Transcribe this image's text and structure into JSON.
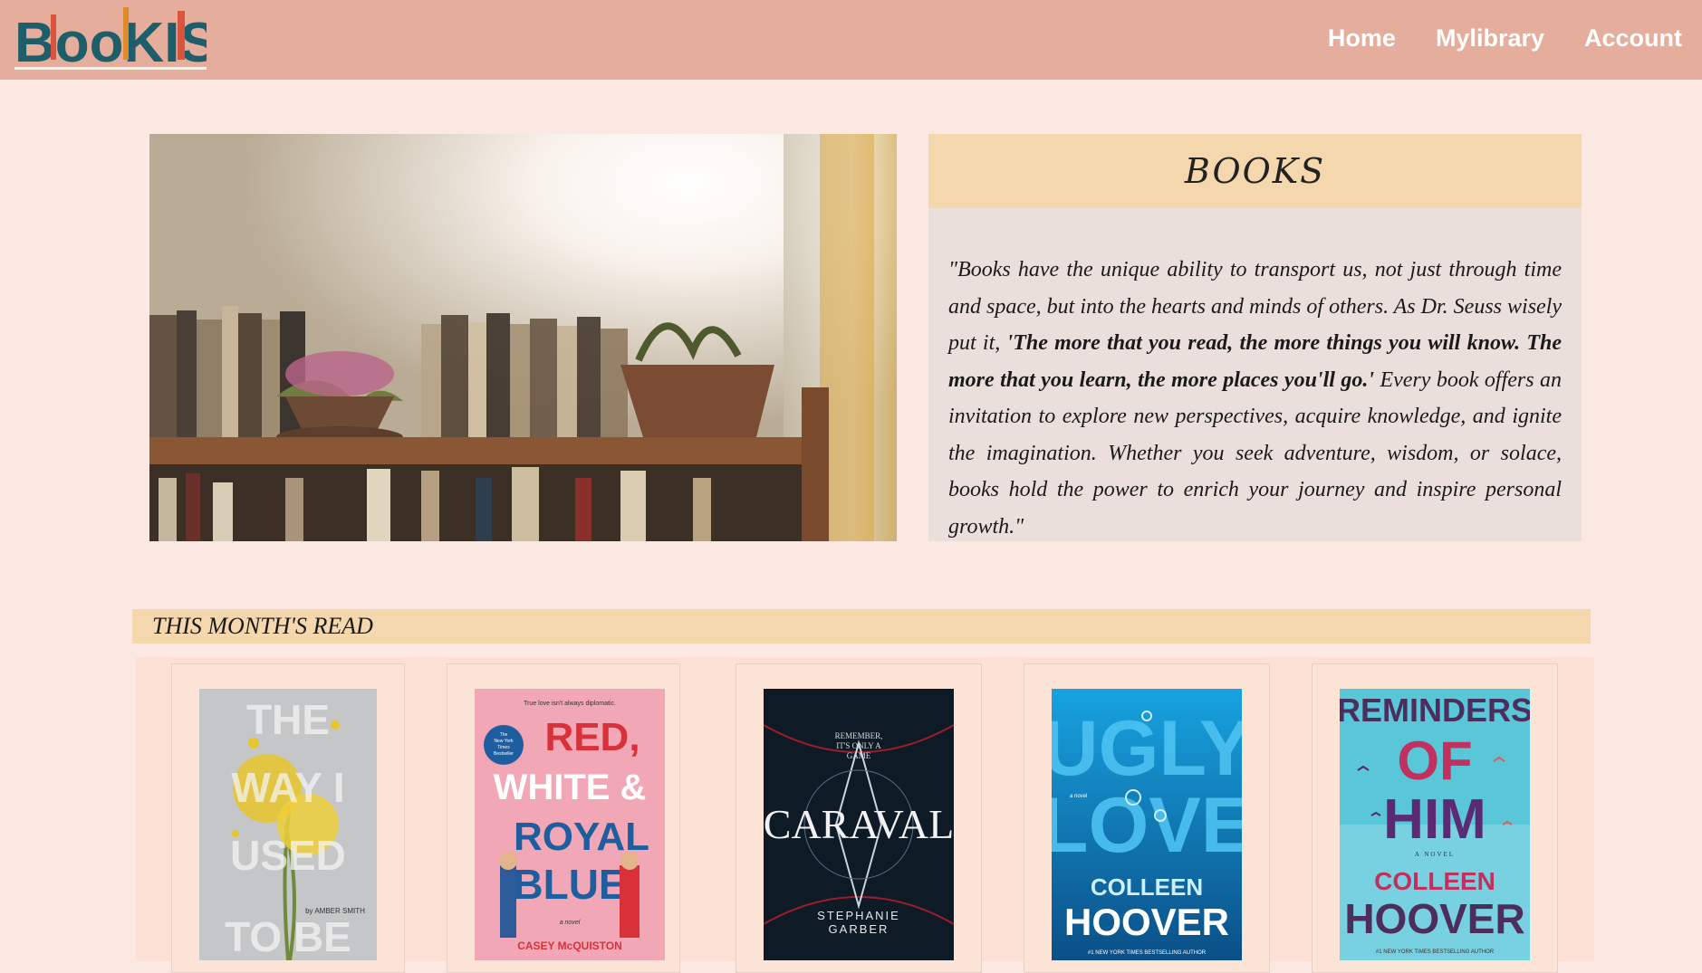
{
  "logo": {
    "text": "BooKISH"
  },
  "nav": {
    "home": "Home",
    "library": "Mylibrary",
    "account": "Account"
  },
  "books_card": {
    "title": "BOOKS",
    "quote_part1": "\"Books have the unique ability to transport us, not just through time and space, but into the hearts and minds of others. As Dr. Seuss wisely put it, ",
    "quote_bold": "'The more that you read, the more things you will know. The more that you learn, the more places you'll go.'",
    "quote_part2": " Every book offers an invitation to explore new perspectives, acquire knowledge, and ignite the imagination. Whether you seek adventure, wisdom, or solace, books hold the power to enrich your journey and inspire personal growth.\""
  },
  "month_section": {
    "title": "THIS MONTH'S READ"
  },
  "books": [
    {
      "title_lines": [
        "THE",
        "WAY I",
        "USED",
        "TO BE"
      ],
      "author": "by AMBER SMITH"
    },
    {
      "tagline": "True love isn't always diplomatic.",
      "badge": [
        "The",
        "New York",
        "Times",
        "Bestseller"
      ],
      "title_lines": [
        "RED,",
        "WHITE &",
        "ROYAL",
        "BLUE"
      ],
      "subtitle": "a novel",
      "author": "CASEY McQUISTON"
    },
    {
      "tagline_lines": [
        "REMEMBER,",
        "IT'S ONLY A",
        "GAME"
      ],
      "title": "CARAVAL",
      "author_lines": [
        "STEPHANIE",
        "GARBER"
      ]
    },
    {
      "subtitle": "a novel",
      "title_lines": [
        "UGLY",
        "LOVE"
      ],
      "author_lines": [
        "COLLEEN",
        "HOOVER"
      ],
      "footer": "#1 NEW YORK TIMES BESTSELLING AUTHOR"
    },
    {
      "title_lines": [
        "REMINDERS",
        "OF",
        "HIM"
      ],
      "subtitle": "A NOVEL",
      "author_lines": [
        "COLLEEN",
        "HOOVER"
      ],
      "footer": "#1 NEW YORK TIMES BESTSELLING AUTHOR"
    }
  ],
  "colors": {
    "header_bg": "#e5ae9c",
    "page_bg": "#fbe8e2",
    "accent_band": "#f5d7ae",
    "card_bg": "#ebdfdb"
  }
}
